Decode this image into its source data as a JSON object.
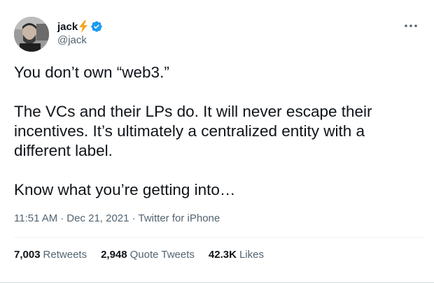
{
  "author": {
    "display_name": "jack",
    "handle": "@jack",
    "avatar_icon": "profile-photo",
    "badge_icons": [
      "lightning-bolt-icon",
      "verified-badge-icon"
    ],
    "verified_color": "#1d9bf0",
    "bolt_color": "#f5a623"
  },
  "tweet": {
    "paragraphs": [
      "You don’t own “web3.”",
      "The VCs and their LPs do. It will never escape their incentives. It’s ultimately a centralized entity with a different label.",
      "Know what you’re getting into…"
    ],
    "time": "11:51 AM",
    "date": "Dec 21, 2021",
    "separator": "·",
    "source": "Twitter for iPhone"
  },
  "stats": {
    "retweets_count": "7,003",
    "retweets_label": "Retweets",
    "quotes_count": "2,948",
    "quotes_label": "Quote Tweets",
    "likes_count": "42.3K",
    "likes_label": "Likes"
  }
}
